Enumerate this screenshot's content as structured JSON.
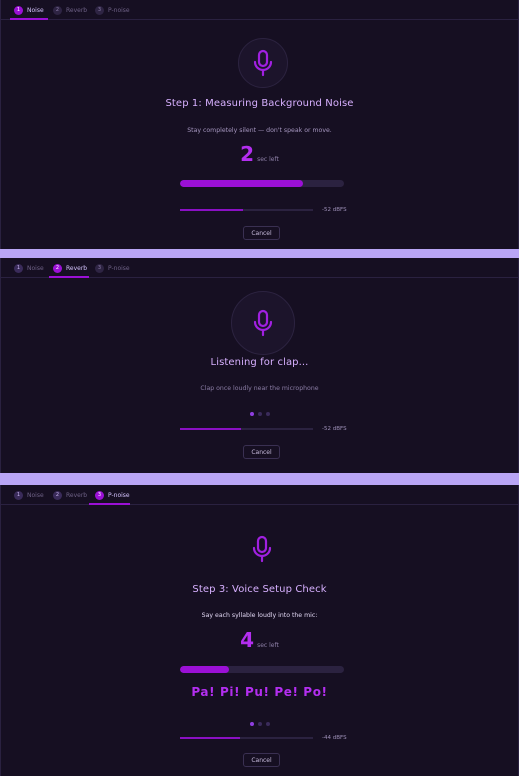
{
  "tabs": [
    {
      "num": "1",
      "label": "Noise"
    },
    {
      "num": "2",
      "label": "Reverb"
    },
    {
      "num": "3",
      "label": "P-noise"
    }
  ],
  "step1": {
    "title": "Step 1: Measuring Background Noise",
    "instruction": "Stay completely silent — don't speak or move.",
    "countdown": "2",
    "countdown_unit": "sec left",
    "progress_fraction": 0.75,
    "level_fraction": 0.47,
    "level_label": "-52 dBFS",
    "cancel_label": "Cancel"
  },
  "step2": {
    "title": "Listening for clap...",
    "instruction": "Clap once loudly near the microphone",
    "level_fraction": 0.46,
    "level_label": "-52 dBFS",
    "cancel_label": "Cancel"
  },
  "step3": {
    "title": "Step 3: Voice Setup Check",
    "instruction": "Say each syllable loudly into the mic:",
    "countdown": "4",
    "countdown_unit": "sec left",
    "progress_fraction": 0.3,
    "syllables": "Pa! Pi! Pu! Pe! Po!",
    "level_fraction": 0.45,
    "level_label": "-44 dBFS",
    "cancel_label": "Cancel"
  },
  "colors": {
    "accent": "#9b10d6",
    "background": "#160f22",
    "separator": "#b9a5f5"
  },
  "icons": {
    "microphone": "microphone-icon"
  }
}
